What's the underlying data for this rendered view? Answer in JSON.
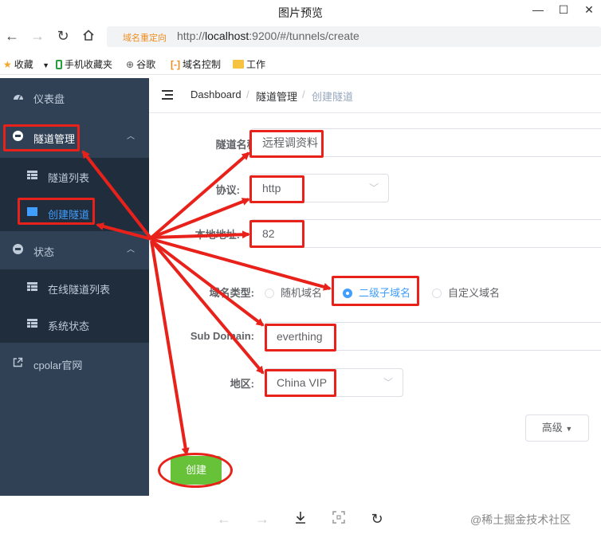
{
  "window": {
    "title": "图片预览",
    "controls": [
      "—",
      "☐",
      "✕"
    ]
  },
  "browser": {
    "redirect_badge": "域名重定向",
    "url_prefix": "http://",
    "url_host": "localhost",
    "url_rest": ":9200/#/tunnels/create",
    "bookmarks": [
      {
        "icon": "star-icon",
        "label": "收藏"
      },
      {
        "icon": "phone-icon",
        "label": "手机收藏夹"
      },
      {
        "icon": "globe-icon",
        "label": "谷歌"
      },
      {
        "icon": "code-icon",
        "label": "域名控制"
      },
      {
        "icon": "folder-icon",
        "label": "工作"
      }
    ]
  },
  "sidebar": {
    "dashboard": "仪表盘",
    "tunnel_mgmt": "隧道管理",
    "tunnel_list": "隧道列表",
    "create_tunnel": "创建隧道",
    "status": "状态",
    "online_tunnels": "在线隧道列表",
    "system_status": "系统状态",
    "website": "cpolar官网"
  },
  "breadcrumb": {
    "items": [
      "Dashboard",
      "隧道管理",
      "创建隧道"
    ],
    "separator": "/"
  },
  "form": {
    "name_label": "隧道名称:",
    "name_value": "远程调资料",
    "protocol_label": "协议:",
    "protocol_value": "http",
    "local_addr_label": "本地地址:",
    "local_addr_value": "82",
    "domain_type_label": "域名类型:",
    "domain_options": [
      "随机域名",
      "二级子域名",
      "自定义域名"
    ],
    "domain_selected": "二级子域名",
    "subdomain_label": "Sub Domain:",
    "subdomain_value": "everthing",
    "region_label": "地区:",
    "region_value": "China VIP",
    "advanced_label": "高级",
    "create_label": "创建"
  },
  "viewer": {
    "watermark": "@稀土掘金技术社区"
  },
  "annotation_color": "#e8221b"
}
